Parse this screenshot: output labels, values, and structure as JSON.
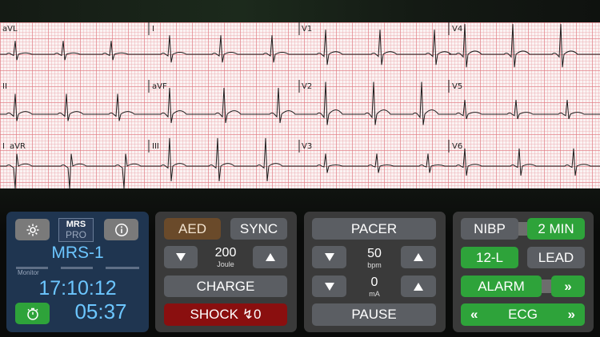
{
  "ecg": {
    "leads": [
      "aVL",
      "I",
      "V1",
      "V4",
      "II",
      "aVF",
      "V2",
      "V5",
      "I",
      "aVR",
      "III",
      "V3",
      "V6"
    ]
  },
  "monitor": {
    "logo_top": "MRS",
    "logo_bottom": "PRO",
    "device_name": "MRS-1",
    "mode_label": "Monitor",
    "clock": "17:10:12",
    "timer": "05:37",
    "settings_icon": "gear-icon",
    "info_icon": "info-icon",
    "timer_icon": "stopwatch-icon"
  },
  "defib": {
    "aed_label": "AED",
    "sync_label": "SYNC",
    "energy_value": "200",
    "energy_unit": "Joule",
    "charge_label": "CHARGE",
    "shock_label": "SHOCK ↯0"
  },
  "pacer": {
    "pacer_label": "PACER",
    "rate_value": "50",
    "rate_unit": "bpm",
    "current_value": "0",
    "current_unit": "mA",
    "pause_label": "PAUSE"
  },
  "controls": {
    "nibp_label": "NIBP",
    "nibp_interval": "2 MIN",
    "twelve_lead_label": "12-L",
    "lead_label": "LEAD",
    "alarm_label": "ALARM",
    "alarm_arrow": "»",
    "ecg_label": "ECG",
    "ecg_left_arrow": "«",
    "ecg_right_arrow": "»"
  },
  "colors": {
    "green": "#2ea33a",
    "red": "#8a0f0f",
    "monitor_panel": "#1f3550",
    "text_blue": "#6cc6ff"
  }
}
